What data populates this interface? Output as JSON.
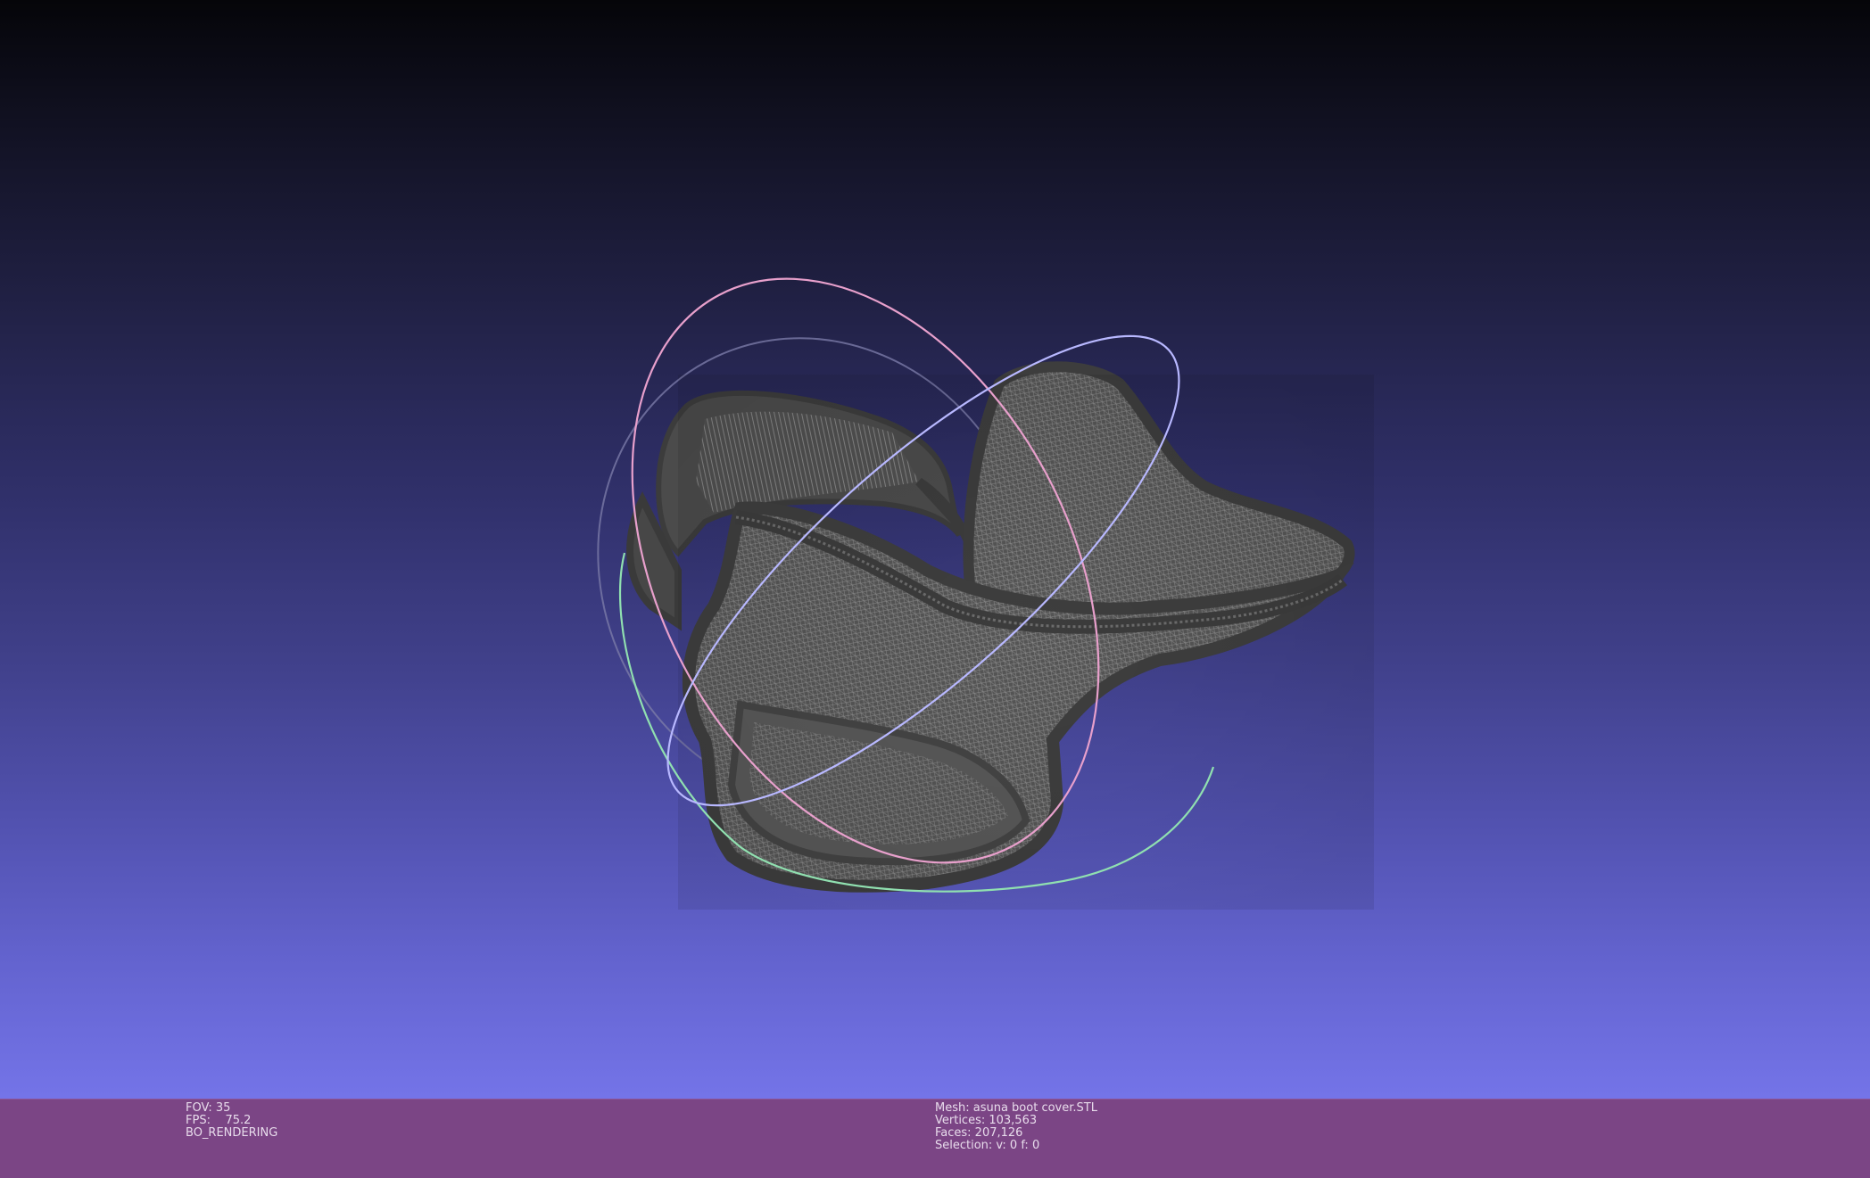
{
  "viewport": {
    "background_top": "#050509",
    "background_bottom": "#7474e8",
    "model_color": "#4a4a4a",
    "trackball_colors": {
      "x_ring": "#f0a0d0",
      "y_ring": "#90e0b0",
      "z_ring": "#b0b0f0"
    }
  },
  "status_bar": {
    "color": "#7b4585",
    "left": {
      "fov": "FOV: 35",
      "fps": "FPS:    75.2",
      "render_mode": "BO_RENDERING"
    },
    "right": {
      "mesh": "Mesh: asuna boot cover.STL",
      "vertices": "Vertices: 103,563",
      "faces": "Faces: 207,126",
      "selection": "Selection: v: 0 f: 0"
    }
  }
}
